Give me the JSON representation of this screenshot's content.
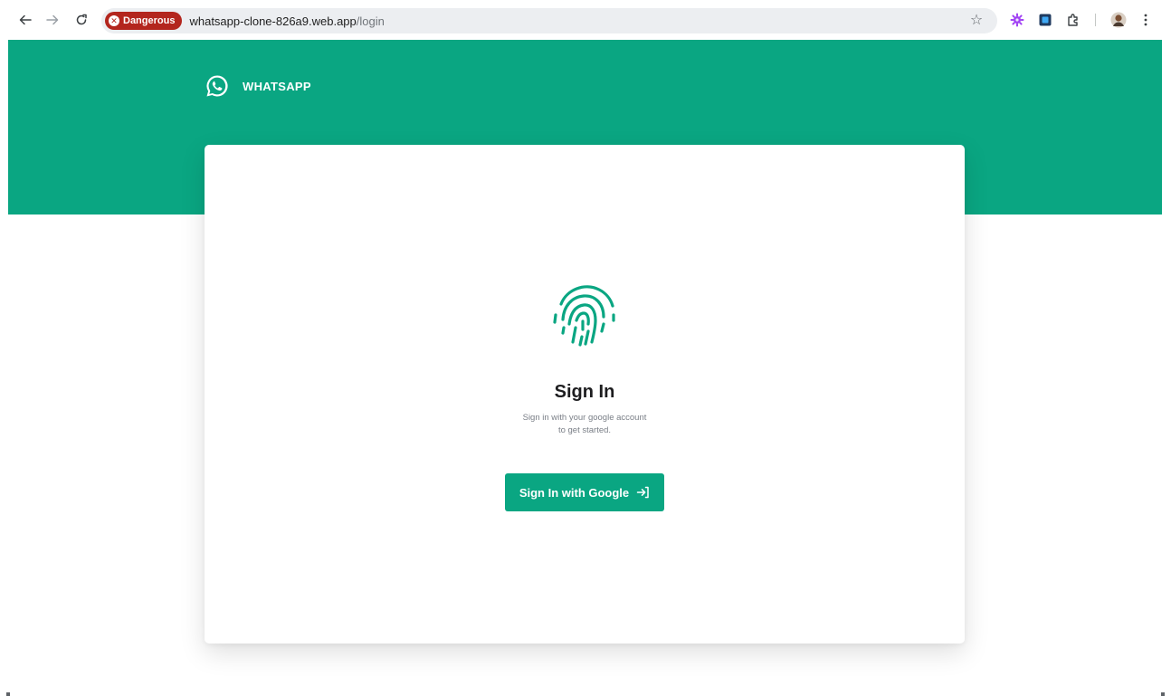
{
  "browser": {
    "security_chip_label": "Dangerous",
    "url_host": "whatsapp-clone-826a9.web.app",
    "url_path": "/login",
    "icons": {
      "back": "arrow-left-icon",
      "forward": "arrow-right-icon",
      "reload": "reload-icon",
      "danger": "x-circle-icon",
      "bookmark": "star-icon",
      "extension_1": "gear-extension-icon",
      "extension_2": "square-extension-icon",
      "extensions_menu": "puzzle-icon",
      "profile": "avatar-icon",
      "menu": "kebab-menu-icon"
    }
  },
  "header": {
    "brand_name": "WHATSAPP",
    "logo_icon": "whatsapp-logo-icon"
  },
  "login_card": {
    "icon": "fingerprint-icon",
    "title": "Sign In",
    "subtitle_line1": "Sign in with your google account",
    "subtitle_line2": "to get started.",
    "button_label": "Sign In with Google",
    "button_icon": "login-arrow-icon"
  },
  "colors": {
    "brand_green": "#0aa682",
    "danger_red": "#b3261e",
    "omnibox_bg": "#eceef1"
  }
}
